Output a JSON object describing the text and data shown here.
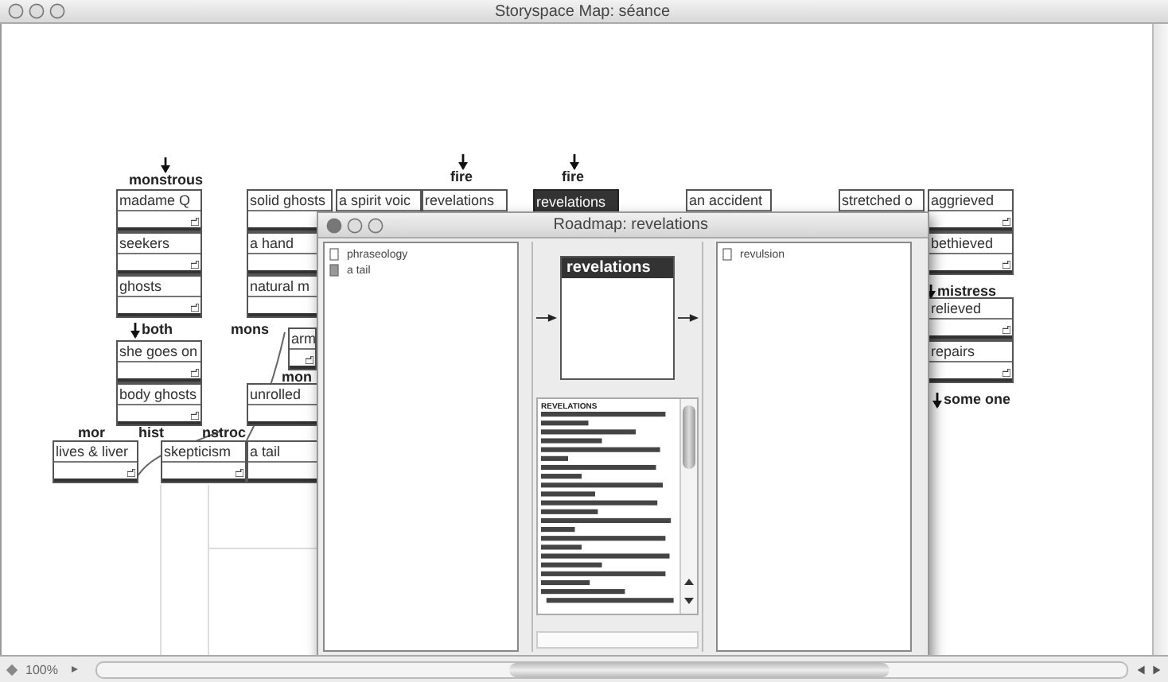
{
  "window": {
    "title": "Storyspace Map: séance",
    "zoom": "100%"
  },
  "map": {
    "nodes": [
      {
        "title": "madame Q",
        "selected": false
      },
      {
        "title": "seekers",
        "selected": false
      },
      {
        "title": "ghosts",
        "selected": false
      },
      {
        "title": "solid ghosts",
        "selected": false
      },
      {
        "title": "a hand",
        "selected": false
      },
      {
        "title": "natural m",
        "selected": false
      },
      {
        "title": "a spirit voic",
        "selected": false
      },
      {
        "title": "revelations",
        "selected": false
      },
      {
        "title": "revelations",
        "selected": true
      },
      {
        "title": "an accident",
        "selected": false
      },
      {
        "title": "stretched o",
        "selected": false
      },
      {
        "title": "aggrieved",
        "selected": false
      },
      {
        "title": "bethieved",
        "selected": false
      },
      {
        "title": "relieved",
        "selected": false
      },
      {
        "title": "repairs",
        "selected": false
      },
      {
        "title": "she goes on",
        "selected": false
      },
      {
        "title": "body ghosts",
        "selected": false
      },
      {
        "title": "arm",
        "selected": false
      },
      {
        "title": "unrolled",
        "selected": false
      },
      {
        "title": "lives & liver",
        "selected": false
      },
      {
        "title": "skepticism",
        "selected": false
      },
      {
        "title": "a tail",
        "selected": false
      }
    ],
    "labels": [
      "monstrous",
      "fire",
      "fire",
      "both",
      "mons",
      "mon",
      "mor",
      "hist",
      "nstroc",
      "mistress",
      "some one"
    ]
  },
  "roadmap": {
    "title": "Roadmap: revelations",
    "incoming": [
      {
        "title": "phraseology"
      },
      {
        "title": "a tail"
      }
    ],
    "current": {
      "title": "revelations",
      "preview_heading": "REVELATIONS"
    },
    "outgoing": [
      {
        "title": "revulsion"
      }
    ]
  }
}
